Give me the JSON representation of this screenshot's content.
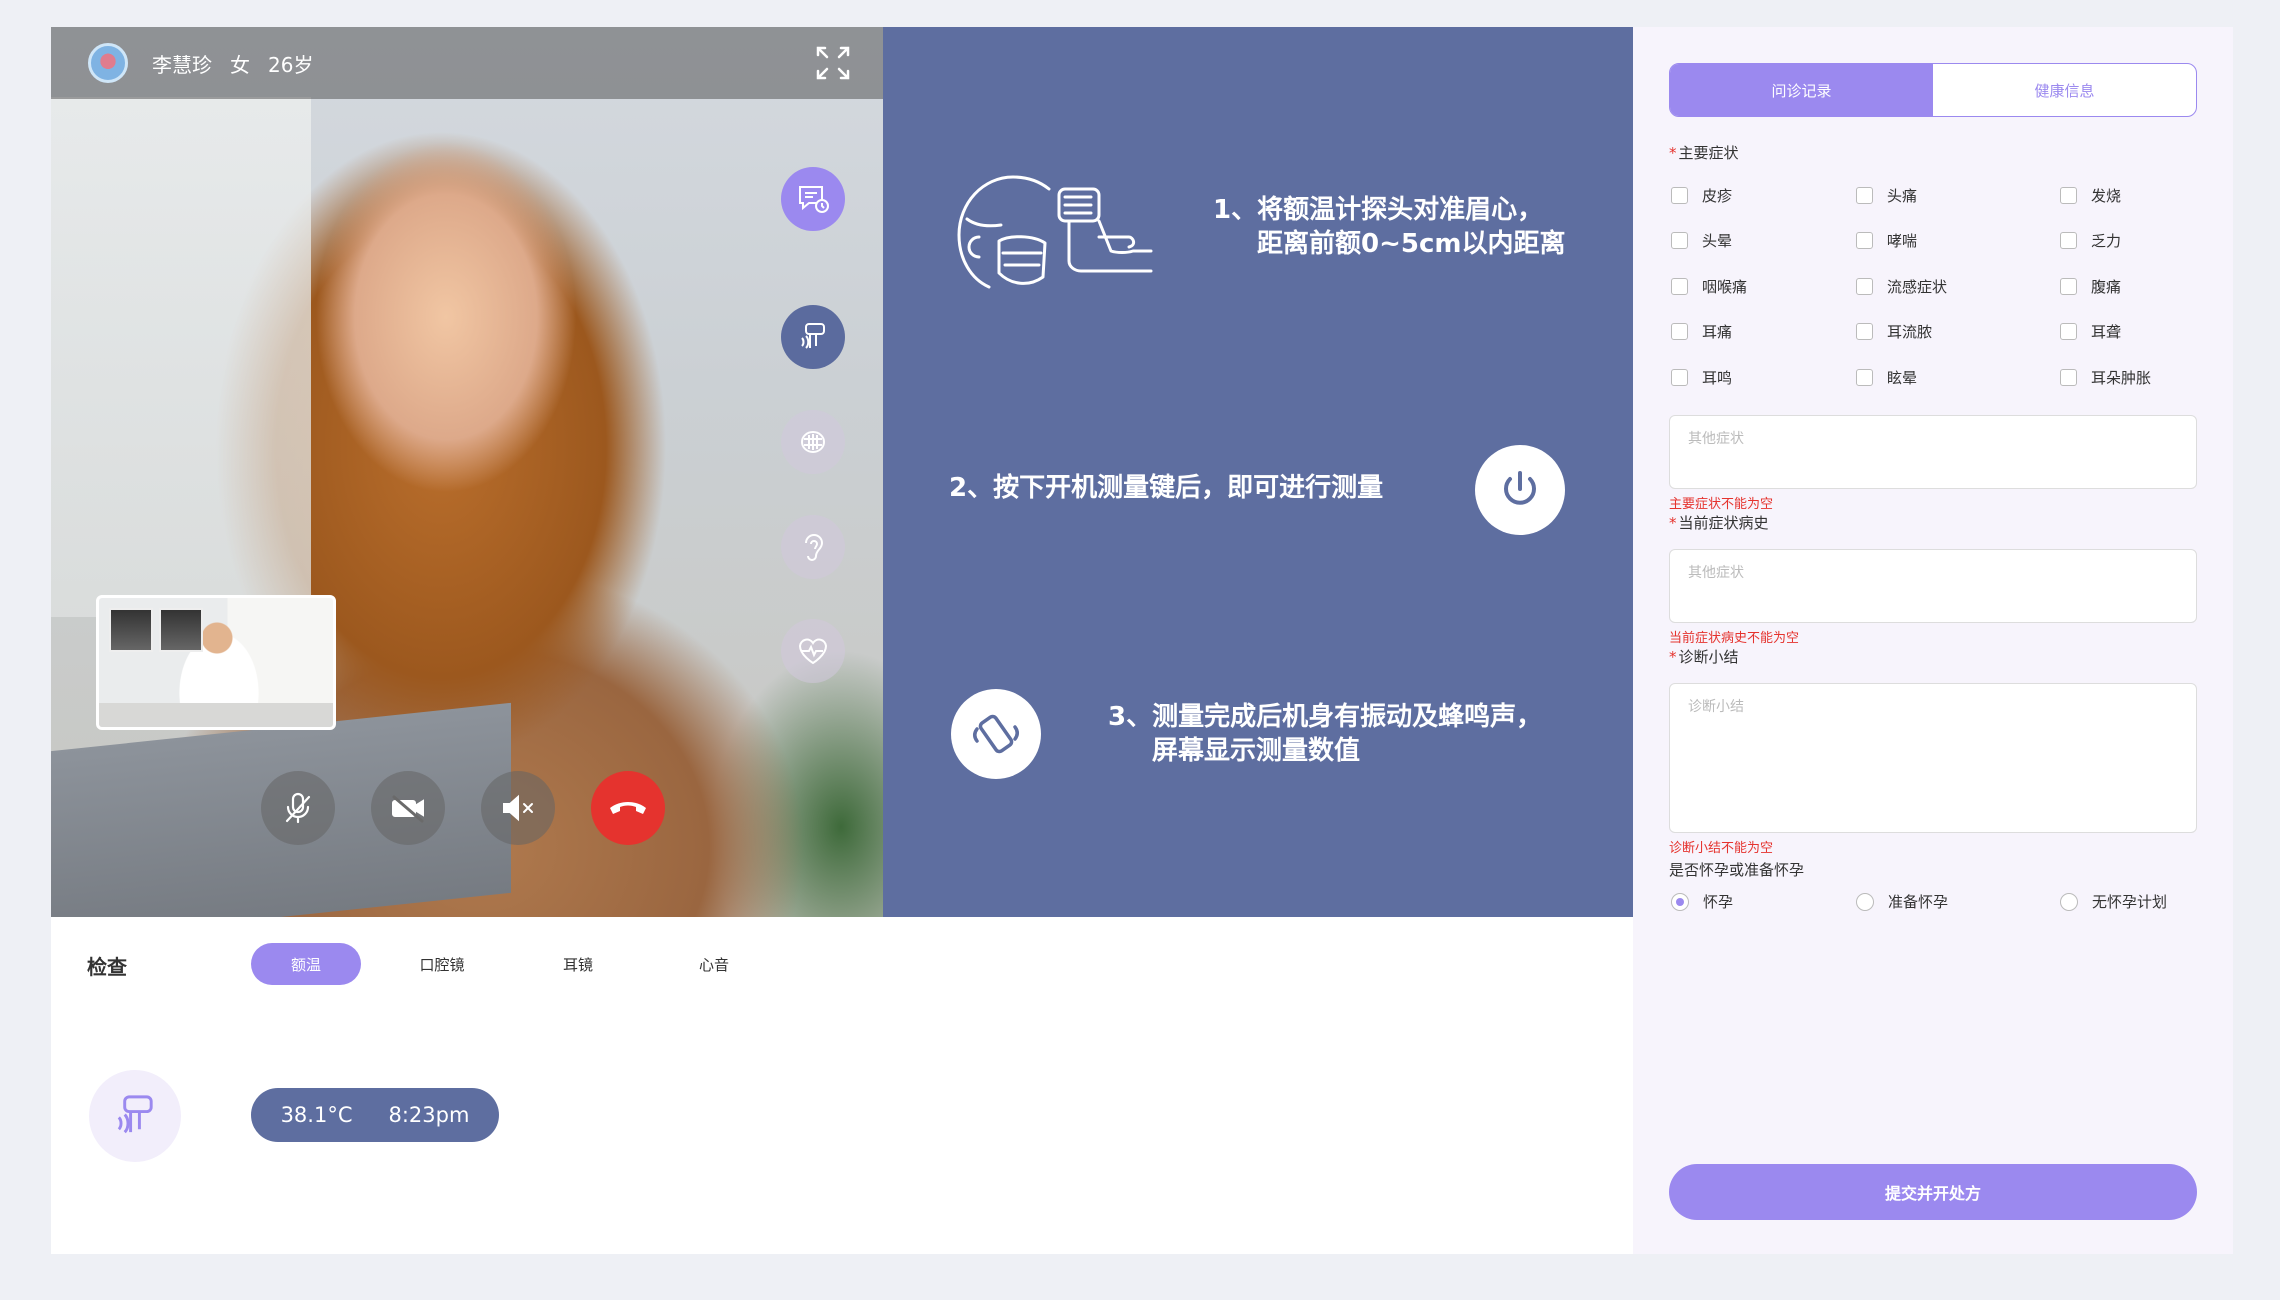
{
  "patient": {
    "name": "李慧珍",
    "gender": "女",
    "age": "26岁"
  },
  "instructions": {
    "step1_line1": "1、将额温计探头对准眉心，",
    "step1_line2": "距离前额0~5cm以内距离",
    "step2": "2、按下开机测量键后，即可进行测量",
    "step3_line1": "3、测量完成后机身有振动及蜂鸣声，",
    "step3_line2": "屏幕显示测量数值"
  },
  "exam": {
    "title": "检查",
    "tabs": [
      "额温",
      "口腔镜",
      "耳镜",
      "心音"
    ],
    "active_tab": "额温",
    "reading": {
      "temperature": "38.1°C",
      "time": "8:23pm"
    }
  },
  "form": {
    "tabs": [
      "问诊记录",
      "健康信息"
    ],
    "active_tab": "问诊记录",
    "main_symptoms": {
      "label": "主要症状",
      "options": [
        "皮疹",
        "头痛",
        "发烧",
        "头晕",
        "哮喘",
        "乏力",
        "咽喉痛",
        "流感症状",
        "腹痛",
        "耳痛",
        "耳流脓",
        "耳聋",
        "耳鸣",
        "眩晕",
        "耳朵肿胀"
      ],
      "other_placeholder": "其他症状",
      "error": "主要症状不能为空"
    },
    "history": {
      "label": "当前症状病史",
      "placeholder": "其他症状",
      "error": "当前症状病史不能为空"
    },
    "summary": {
      "label": "诊断小结",
      "placeholder": "诊断小结",
      "error": "诊断小结不能为空"
    },
    "pregnancy": {
      "label": "是否怀孕或准备怀孕",
      "options": [
        "怀孕",
        "准备怀孕",
        "无怀孕计划"
      ],
      "selected": "怀孕"
    },
    "submit_label": "提交并开处方"
  },
  "colors": {
    "accent": "#9b89ef",
    "panel": "#5e6ea0",
    "error": "#e5332e"
  }
}
